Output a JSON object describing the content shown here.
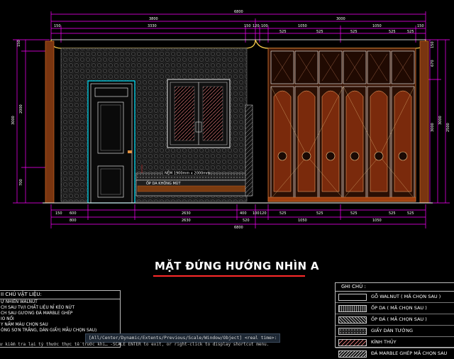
{
  "drawing": {
    "title": "MẶT ĐỨNG HƯỚNG NHÌN A",
    "colors": {
      "background": "#000000",
      "dimension": "#ff00ff",
      "accent": "#ff2a2a",
      "wood": "#b85a1e",
      "cyan": "#00e5ff"
    },
    "top_dims": {
      "overall": "6800",
      "row2": [
        "3800",
        "3000"
      ],
      "row3": [
        "150",
        "3330",
        "150",
        "120",
        "100",
        "1050",
        "1050",
        "150"
      ],
      "row4": [
        "525",
        "525",
        "525",
        "525",
        "525",
        "525"
      ]
    },
    "left_dims": [
      "150",
      "2000",
      "700",
      "3000"
    ],
    "right_dims": [
      "670",
      "3000",
      "3000",
      "2500",
      "150"
    ],
    "bottom_dims": {
      "row1": [
        "150",
        "600",
        "2630",
        "400",
        "100",
        "120",
        "525",
        "525",
        "525",
        "525",
        "525",
        "525",
        "150"
      ],
      "row2": [
        "800",
        "2630",
        "520",
        "1050",
        "1050",
        "1050"
      ],
      "overall": "6800"
    },
    "callouts": {
      "mirror": "NỆM 1900mm x 2000mm",
      "headboard": "ỐP DA KHÔNG MÚT"
    }
  },
  "legend_left": {
    "header": "II CHÚ VẬT LIỆU:",
    "rows": [
      "Ự NHIÊN WALNUT",
      "CH SAU TV/I CHẤT LIỆU NỈ KÈO NỨT",
      "CH SAU GƯƠNG ĐÁ MARBLE GHÉP",
      "IO NỔI",
      "Y NẤM MÀU CHỌN SAU",
      "ÓNG SƠN TRẮNG, DÁN GIẤY( MẪU CHỌN SAU)"
    ]
  },
  "legend_right": {
    "header": "GHI CHÚ :",
    "rows": [
      {
        "label": "GỖ WALNUT ( MÃ CHỌN SAU )",
        "icon": "wood-swatch-icon"
      },
      {
        "label": "ỐP DA ( MÃ CHỌN SAU )",
        "icon": "leather-swatch-icon"
      },
      {
        "label": "ỐP ĐÁ ( MÃ CHỌN SAU )",
        "icon": "stone-swatch-icon"
      },
      {
        "label": "GIẤY DÁN TƯỜNG",
        "icon": "wallpaper-swatch-icon"
      },
      {
        "label": "KÍNH THỦY",
        "icon": "glass-swatch-icon"
      },
      {
        "label": "ĐÁ MARBLE GHÉP MÃ CHỌN SAU",
        "icon": "marble-swatch-icon"
      }
    ]
  },
  "command_line": {
    "prompt": "[All/Center/Dynamic/Extents/Previous/Scale/Window/Object] <real time>:",
    "history": "ư kiểm tra lại tỷ thước thực tế trước khi… -SCALE ENTER to exit, or right-click to display shortcut menu."
  }
}
